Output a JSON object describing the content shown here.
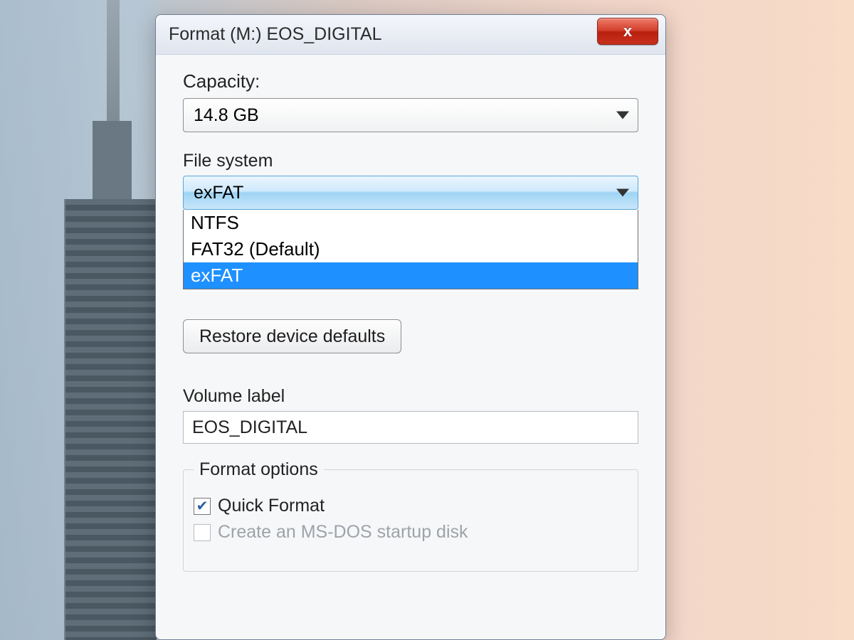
{
  "dialog": {
    "title": "Format (M:) EOS_DIGITAL",
    "close_glyph": "x"
  },
  "capacity": {
    "label": "Capacity:",
    "value": "14.8 GB"
  },
  "filesystem": {
    "label": "File system",
    "value": "exFAT",
    "options": [
      "NTFS",
      "FAT32 (Default)",
      "exFAT"
    ],
    "selected_index": 2
  },
  "restore_button": "Restore device defaults",
  "volume_label": {
    "label": "Volume label",
    "value": "EOS_DIGITAL"
  },
  "format_options": {
    "legend": "Format options",
    "quick_format": {
      "label": "Quick Format",
      "checked": true
    },
    "msdos": {
      "label": "Create an MS-DOS startup disk",
      "checked": false
    }
  }
}
